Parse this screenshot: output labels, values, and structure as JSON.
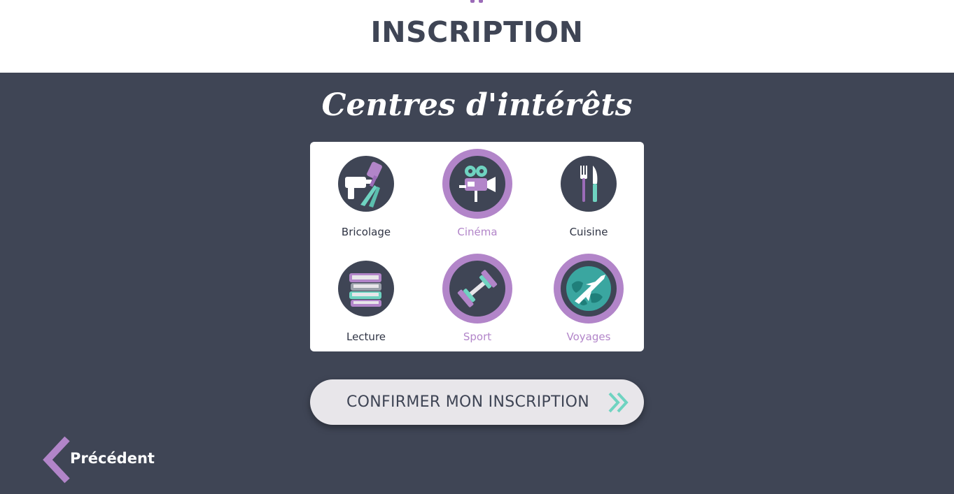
{
  "header": {
    "title": "INSCRIPTION"
  },
  "section": {
    "title": "Centres d'intérêts"
  },
  "interests": [
    {
      "label": "Bricolage",
      "icon": "tools-icon",
      "selected": false
    },
    {
      "label": "Cinéma",
      "icon": "movie-camera-icon",
      "selected": true
    },
    {
      "label": "Cuisine",
      "icon": "fork-knife-icon",
      "selected": false
    },
    {
      "label": "Lecture",
      "icon": "books-icon",
      "selected": false
    },
    {
      "label": "Sport",
      "icon": "dumbbell-icon",
      "selected": true
    },
    {
      "label": "Voyages",
      "icon": "globe-plane-icon",
      "selected": true
    }
  ],
  "confirm_button": {
    "label": "CONFIRMER MON INSCRIPTION",
    "icon": "double-chevron-right-icon"
  },
  "previous_link": {
    "label": "Précédent",
    "icon": "chevron-left-icon"
  },
  "colors": {
    "background": "#3f4555",
    "accent": "#b285c9",
    "teal": "#6fd3c1",
    "card": "#ffffff"
  }
}
